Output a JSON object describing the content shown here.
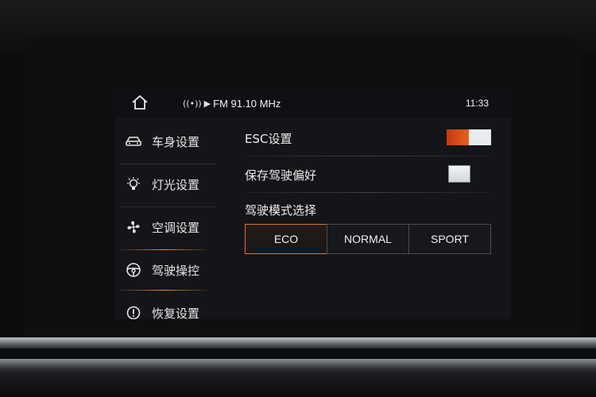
{
  "status_bar": {
    "home_icon": "home-icon",
    "radio_icon": "radio-signal-icon",
    "radio_text": "FM 91.10 MHz",
    "clock": "11:33"
  },
  "sidebar": {
    "items": [
      {
        "label": "车身设置",
        "icon": "car-body-icon",
        "active": false
      },
      {
        "label": "灯光设置",
        "icon": "light-bulb-icon",
        "active": false
      },
      {
        "label": "空调设置",
        "icon": "fan-icon",
        "active": false
      },
      {
        "label": "驾驶操控",
        "icon": "steering-wheel-icon",
        "active": true
      },
      {
        "label": "恢复设置",
        "icon": "alert-icon",
        "active": false
      }
    ]
  },
  "settings": {
    "esc_label": "ESC设置",
    "esc_on": true,
    "save_pref_label": "保存驾驶偏好",
    "save_pref_checked": false,
    "drive_mode_label": "驾驶模式选择",
    "modes": [
      "ECO",
      "NORMAL",
      "SPORT"
    ],
    "selected_mode": "ECO"
  },
  "colors": {
    "accent": "#e8621d",
    "background": "#141518"
  }
}
